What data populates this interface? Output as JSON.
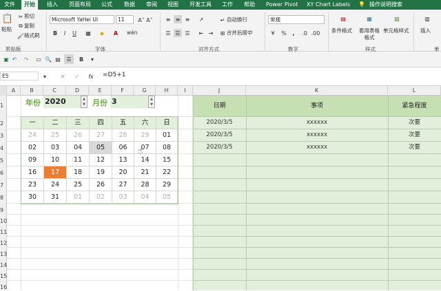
{
  "menu": {
    "tabs": [
      "文件",
      "开始",
      "插入",
      "页面布局",
      "公式",
      "数据",
      "审阅",
      "视图",
      "开发工具",
      "工作",
      "帮助",
      "Power Pivot",
      "XY Chart Labels"
    ],
    "tell_me": "操作说明搜索",
    "active": "开始"
  },
  "ribbon": {
    "clipboard": {
      "paste": "粘贴",
      "cut": "剪切",
      "copy": "复制",
      "format_painter": "格式刷",
      "label": "剪贴板"
    },
    "font": {
      "name": "Microsoft YaHei UI",
      "size": "11",
      "bold": "B",
      "italic": "I",
      "underline": "U",
      "wen": "wén",
      "label": "字体"
    },
    "alignment": {
      "wrap": "自动换行",
      "merge": "合并后居中",
      "label": "对齐方式"
    },
    "number": {
      "format": "常规",
      "currency": "¥",
      "percent": "%",
      "comma": ",",
      "label": "数字"
    },
    "styles": {
      "conditional": "条件格式",
      "table": "套用表格格式",
      "cell": "单元格样式",
      "label": "样式"
    },
    "cells": {
      "insert": "插入",
      "label": "单"
    }
  },
  "formula_bar": {
    "name_box": "E5",
    "cancel": "✕",
    "enter": "✓",
    "fx": "fx",
    "formula": "=D5+1"
  },
  "columns": [
    "A",
    "B",
    "C",
    "D",
    "E",
    "F",
    "G",
    "H",
    "I",
    "J",
    "K",
    "L"
  ],
  "rows": [
    "1",
    "2",
    "3",
    "4",
    "5",
    "6",
    "7",
    "8",
    "9",
    "10",
    "11",
    "12",
    "13",
    "14",
    "15",
    "16"
  ],
  "calendar": {
    "year_label": "年份",
    "year": "2020",
    "month_label": "月份",
    "month": "3",
    "weekdays": [
      "一",
      "二",
      "三",
      "四",
      "五",
      "六",
      "日"
    ],
    "weeks": [
      [
        "24",
        "25",
        "26",
        "27",
        "28",
        "29",
        "01"
      ],
      [
        "02",
        "03",
        "04",
        "05",
        "06",
        "07",
        "08"
      ],
      [
        "09",
        "10",
        "11",
        "12",
        "13",
        "14",
        "15"
      ],
      [
        "16",
        "17",
        "18",
        "19",
        "20",
        "21",
        "22"
      ],
      [
        "23",
        "24",
        "25",
        "26",
        "27",
        "28",
        "29"
      ],
      [
        "30",
        "31",
        "01",
        "02",
        "03",
        "04",
        "05"
      ]
    ]
  },
  "events": {
    "headers": [
      "日期",
      "事项",
      "紧急程度"
    ],
    "rows": [
      {
        "date": "2020/3/5",
        "item": "xxxxxx",
        "urgency": "次要"
      },
      {
        "date": "2020/3/5",
        "item": "xxxxxx",
        "urgency": "次要"
      },
      {
        "date": "2020/3/5",
        "item": "xxxxxx",
        "urgency": "次要"
      }
    ]
  },
  "colors": {
    "excel_green": "#217346",
    "header_green": "#c6e0b4",
    "row_green": "#e2efda",
    "today": "#ed7d31",
    "label_green": "#70ad47"
  }
}
